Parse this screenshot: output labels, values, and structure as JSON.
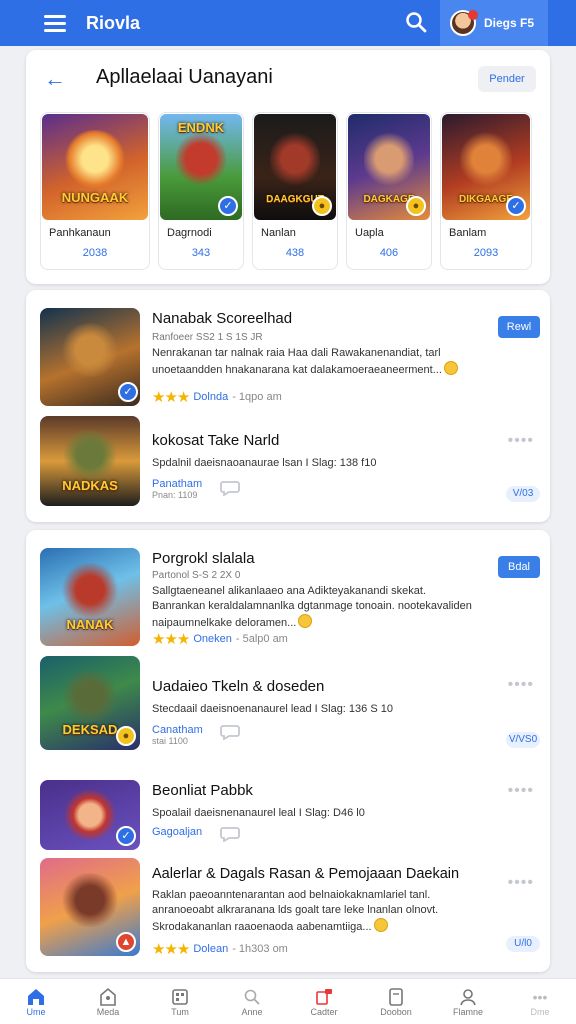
{
  "topbar": {
    "brand": "Riovla",
    "username": "Diegs F5"
  },
  "featured": {
    "title": "Apllaelaai Uanayani",
    "action_label": "Pender",
    "items": [
      {
        "art_text": "NUNGAAK",
        "name": "Panhkanaun",
        "count": "2038",
        "badge": "none"
      },
      {
        "art_text": "ENDNK",
        "name": "Dagrnodi",
        "count": "343",
        "badge": "check"
      },
      {
        "art_text": "DAAGKGUT",
        "name": "Nanlan",
        "count": "438",
        "badge": "yellow"
      },
      {
        "art_text": "DAGKAGE",
        "name": "Uapla",
        "count": "406",
        "badge": "yellow"
      },
      {
        "art_text": "DIKGAAGE",
        "name": "Banlam",
        "count": "2093",
        "badge": "check"
      }
    ]
  },
  "list1": [
    {
      "title": "Nanabak Scoreelhad",
      "subtitle": "Ranfoeer SS2 1 S 1S JR",
      "description": "Nenrakanan tar nalnak raia Haa dali Rawakanenandiat, tarl unoetaandden hnakanarana kat dalakamoeraeaneerment...",
      "rating_stars": "★★★",
      "category": "Dolnda",
      "time": "- 1qpo am",
      "action_label": "Rewl",
      "art_text": "",
      "badge": "check"
    },
    {
      "title": "kokosat Take Narld",
      "subtitle": "",
      "description": "Spdalnil daeisnaoanaurae lsan I Slag: 138 f10",
      "rating_stars": "",
      "category": "Panatham",
      "time": "Pnan: 1109",
      "tag": "V/03",
      "art_text": "NADKAS",
      "badge": "none"
    }
  ],
  "list2": [
    {
      "title": "Porgrokl slalala",
      "subtitle": "Partonol S-S 2 2X 0",
      "description": "Sallgtaeneanel alikanlaaeo ana Adikteyakanandi skekat. Banrankan keraldalamnanlka dgtanmage tonoain. nootekavaliden naipaumnelkake deloramen...",
      "rating_stars": "★★★",
      "category": "Oneken",
      "time": "- 5alp0 am",
      "action_label": "Bdal",
      "art_text": "NANAK",
      "badge": "none"
    },
    {
      "title": "Uadaieo Tkeln & doseden",
      "subtitle": "",
      "description": "Stecdaail daeisnoenanaurel lead I Slag: 136 S 10",
      "rating_stars": "",
      "category": "Canatham",
      "time": "stai 1100",
      "tag": "V/VS0",
      "art_text": "DEKSAD",
      "badge": "yellow"
    },
    {
      "title": "Beonliat Pabbk",
      "subtitle": "",
      "description": "Spoalail daeisnenanaurel leal I Slag: D46 l0",
      "rating_stars": "",
      "category": "Gagoaljan",
      "time": "",
      "art_text": "",
      "badge": "check"
    },
    {
      "title": "Aalerlar & Dagals Rasan & Pemojaaan Daekain",
      "subtitle": "",
      "description": "Raklan paeoanntenarantan aod belnaiokaknamlariel tanl. anranoeoabt alkraranana lds goalt tare leke lnanlan olnovt. Skrodakananlan raaoenaoda aabenamtiiga...",
      "rating_stars": "★★★",
      "category": "Dolean",
      "time": "- 1h303 om",
      "tag": "U/l0",
      "art_text": "",
      "badge": "red"
    }
  ],
  "bottom_nav": [
    {
      "label": "Ume",
      "icon": "home-icon",
      "active": true
    },
    {
      "label": "Meda",
      "icon": "store-icon",
      "active": false
    },
    {
      "label": "Tum",
      "icon": "grid-icon",
      "active": false
    },
    {
      "label": "Anne",
      "icon": "search-icon",
      "active": false
    },
    {
      "label": "Cadter",
      "icon": "notification-icon",
      "active": false
    },
    {
      "label": "Doobon",
      "icon": "library-icon",
      "active": false
    },
    {
      "label": "Flamne",
      "icon": "profile-icon",
      "active": false
    },
    {
      "label": "Dme",
      "icon": "more-icon",
      "active": false
    }
  ],
  "colors": {
    "primary": "#2f6fe6",
    "star": "#f4b400",
    "tag_bg": "#e8f0fd"
  }
}
